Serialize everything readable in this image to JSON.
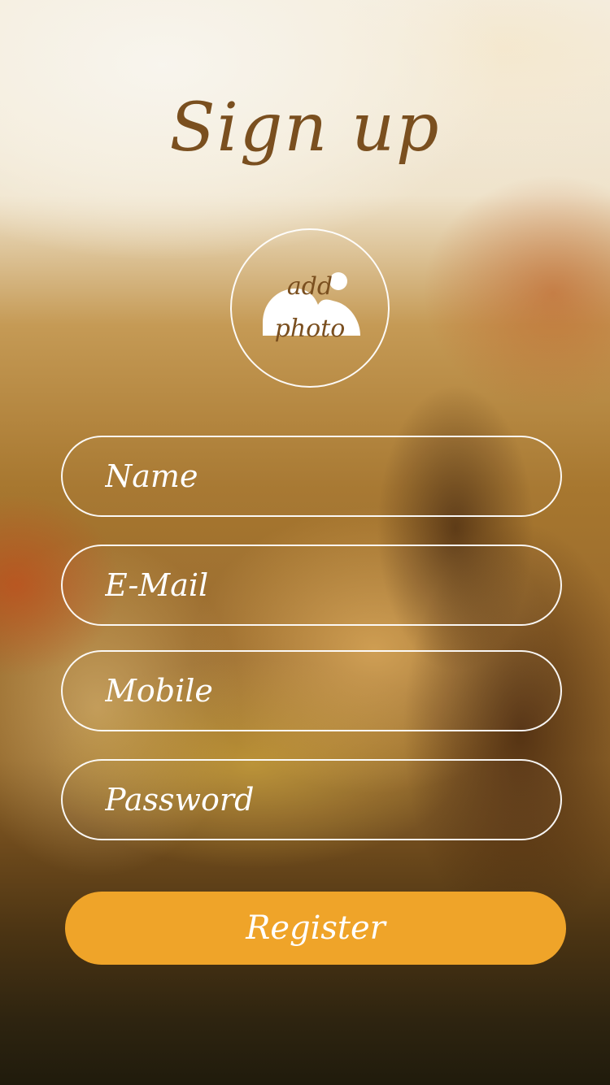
{
  "header": {
    "title": "Sign up"
  },
  "photo": {
    "line1": "add",
    "line2": "photo"
  },
  "form": {
    "name_placeholder": "Name",
    "email_placeholder": "E-Mail",
    "mobile_placeholder": "Mobile",
    "password_placeholder": "Password",
    "name_value": "",
    "email_value": "",
    "mobile_value": "",
    "password_value": ""
  },
  "actions": {
    "register_label": "Register"
  },
  "colors": {
    "accent": "#efa429",
    "title": "#7a4f1f",
    "field_border": "#ffffff"
  }
}
